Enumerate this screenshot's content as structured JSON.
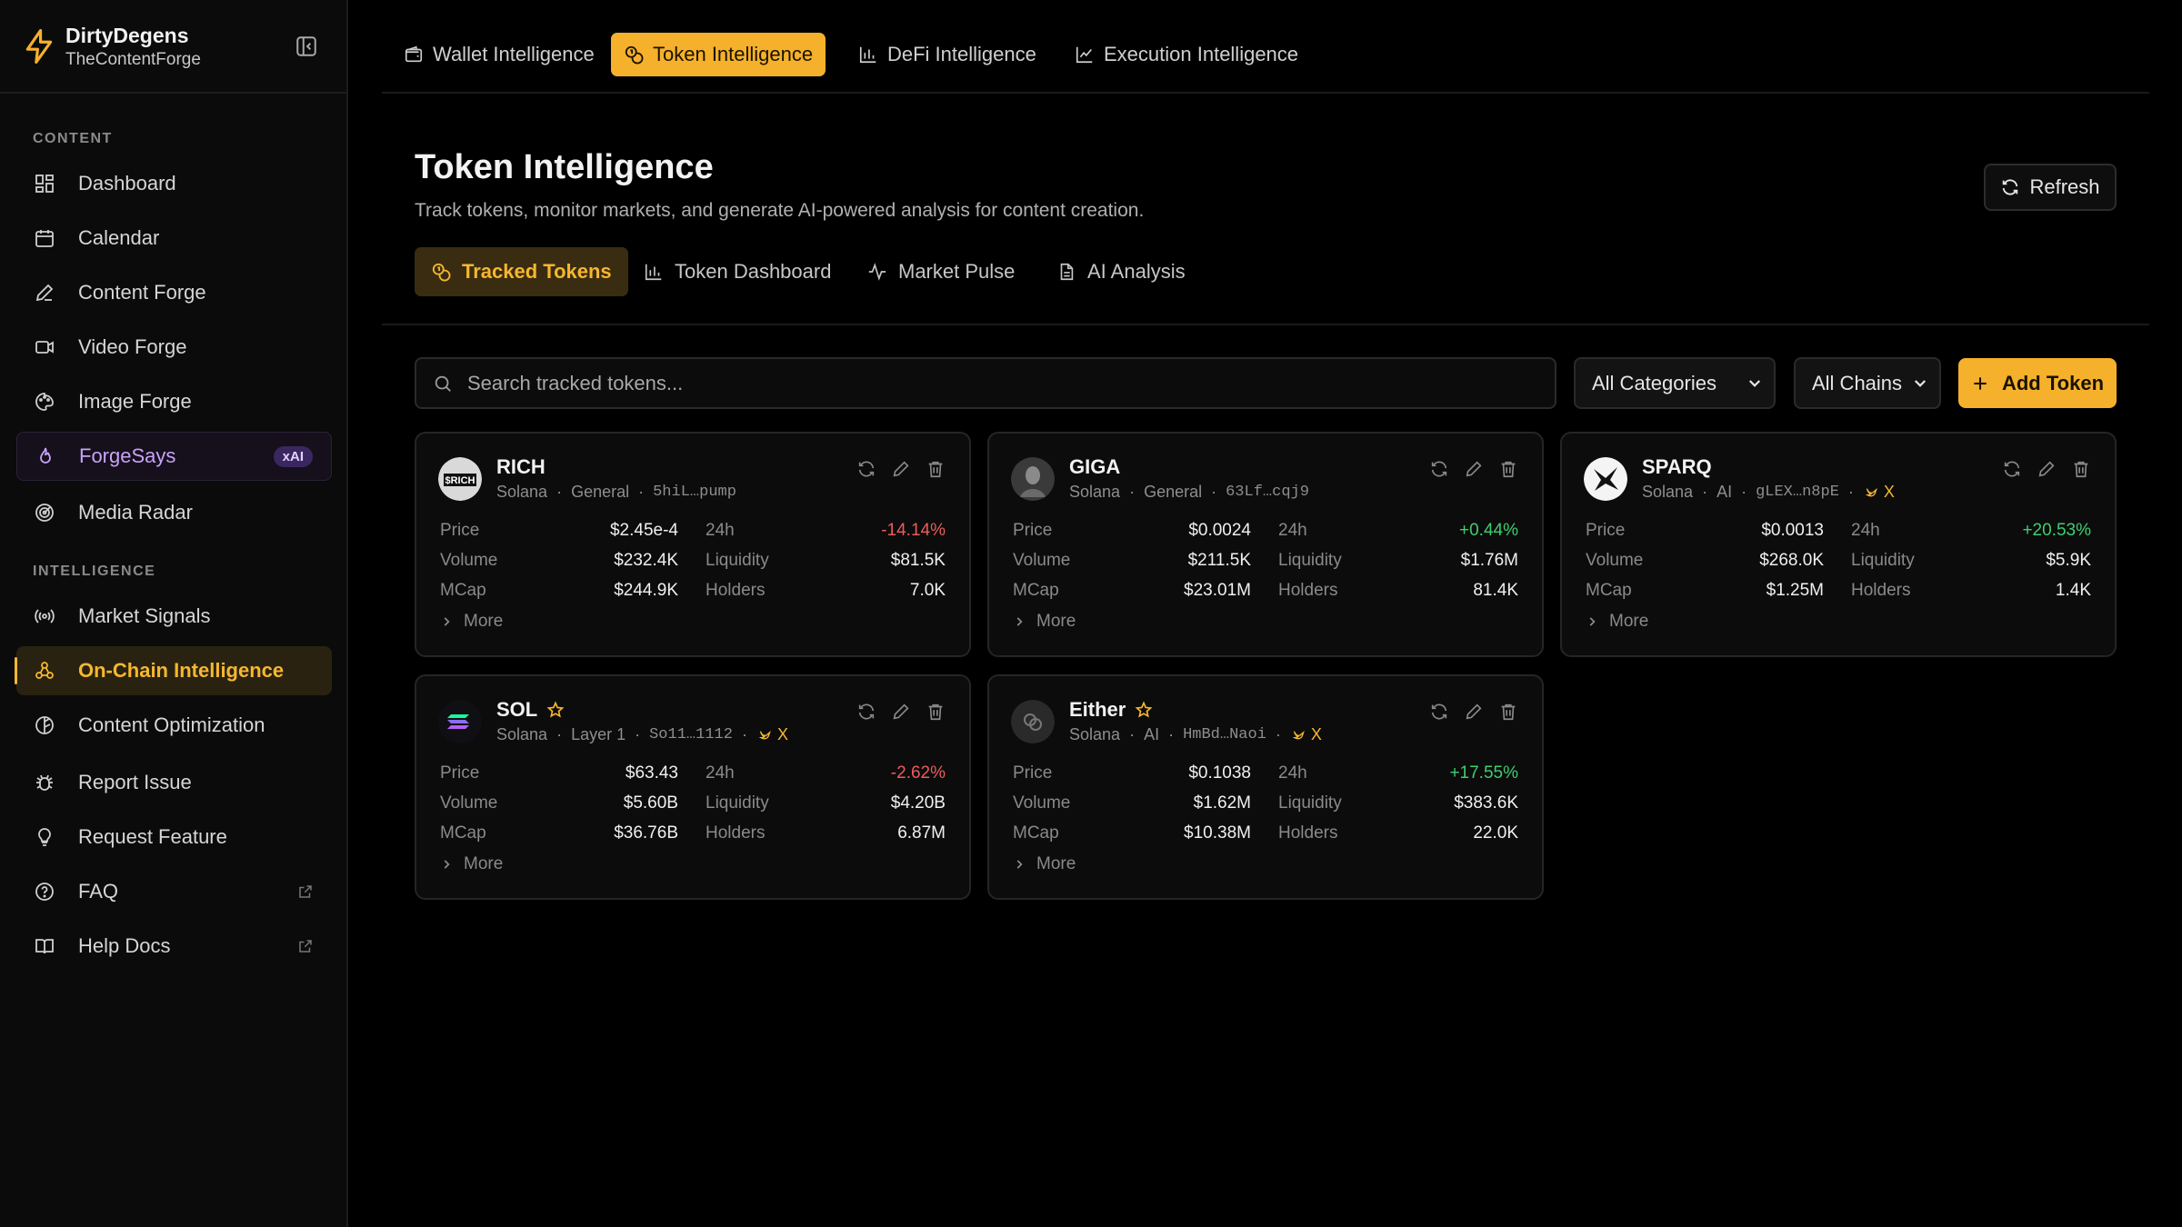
{
  "app": {
    "name": "DirtyDegens",
    "workspace": "TheContentForge"
  },
  "sidebar": {
    "content_label": "CONTENT",
    "intelligence_label": "INTELLIGENCE",
    "items": [
      {
        "label": "Dashboard",
        "icon": "grid-icon"
      },
      {
        "label": "Calendar",
        "icon": "calendar-icon"
      },
      {
        "label": "Content Forge",
        "icon": "pen-icon"
      },
      {
        "label": "Video Forge",
        "icon": "video-icon"
      },
      {
        "label": "Image Forge",
        "icon": "palette-icon"
      },
      {
        "label": "ForgeSays",
        "icon": "flame-icon",
        "badge": "xAI"
      },
      {
        "label": "Media Radar",
        "icon": "radar-icon"
      },
      {
        "label": "Market Signals",
        "icon": "signal-icon"
      },
      {
        "label": "On-Chain Intelligence",
        "icon": "network-icon"
      },
      {
        "label": "Content Optimization",
        "icon": "optimize-icon"
      },
      {
        "label": "Report Issue",
        "icon": "bug-icon"
      },
      {
        "label": "Request Feature",
        "icon": "lightbulb-icon"
      },
      {
        "label": "FAQ",
        "icon": "help-circle-icon"
      },
      {
        "label": "Help Docs",
        "icon": "book-icon"
      }
    ]
  },
  "top_tabs": [
    {
      "label": "Wallet Intelligence",
      "icon": "wallet-icon"
    },
    {
      "label": "Token Intelligence",
      "icon": "coins-icon"
    },
    {
      "label": "DeFi Intelligence",
      "icon": "bar-chart-icon"
    },
    {
      "label": "Execution Intelligence",
      "icon": "line-chart-icon"
    }
  ],
  "header": {
    "title": "Token Intelligence",
    "description": "Track tokens, monitor markets, and generate AI-powered analysis for content creation.",
    "refresh_label": "Refresh"
  },
  "sub_tabs": [
    {
      "label": "Tracked Tokens",
      "icon": "coins-icon"
    },
    {
      "label": "Token Dashboard",
      "icon": "bar-chart-icon"
    },
    {
      "label": "Market Pulse",
      "icon": "pulse-icon"
    },
    {
      "label": "AI Analysis",
      "icon": "document-icon"
    }
  ],
  "toolbar": {
    "search_placeholder": "Search tracked tokens...",
    "category_value": "All Categories",
    "chain_value": "All Chains",
    "add_label": "Add Token"
  },
  "labels": {
    "price": "Price",
    "h24": "24h",
    "volume": "Volume",
    "liquidity": "Liquidity",
    "mcap": "MCap",
    "holders": "Holders",
    "more": "More",
    "x": "X"
  },
  "tokens": [
    {
      "name": "RICH",
      "chain": "Solana",
      "category": "General",
      "address": "5hiL…pump",
      "price": "$2.45e-4",
      "change": "-14.14%",
      "volume": "$232.4K",
      "liquidity": "$81.5K",
      "mcap": "$244.9K",
      "holders": "7.0K"
    },
    {
      "name": "GIGA",
      "chain": "Solana",
      "category": "General",
      "address": "63Lf…cqj9",
      "price": "$0.0024",
      "change": "+0.44%",
      "volume": "$211.5K",
      "liquidity": "$1.76M",
      "mcap": "$23.01M",
      "holders": "81.4K"
    },
    {
      "name": "SPARQ",
      "chain": "Solana",
      "category": "AI",
      "address": "gLEX…n8pE",
      "price": "$0.0013",
      "change": "+20.53%",
      "volume": "$268.0K",
      "liquidity": "$5.9K",
      "mcap": "$1.25M",
      "holders": "1.4K"
    },
    {
      "name": "SOL",
      "chain": "Solana",
      "category": "Layer 1",
      "address": "So11…1112",
      "price": "$63.43",
      "change": "-2.62%",
      "volume": "$5.60B",
      "liquidity": "$4.20B",
      "mcap": "$36.76B",
      "holders": "6.87M"
    },
    {
      "name": "Either",
      "chain": "Solana",
      "category": "AI",
      "address": "HmBd…Naoi",
      "price": "$0.1038",
      "change": "+17.55%",
      "volume": "$1.62M",
      "liquidity": "$383.6K",
      "mcap": "$10.38M",
      "holders": "22.0K"
    }
  ],
  "colors": {
    "accent": "#f5b12b",
    "negative": "#ef5b5b",
    "positive": "#3ecf6e",
    "xai_badge": "#3a2760"
  }
}
